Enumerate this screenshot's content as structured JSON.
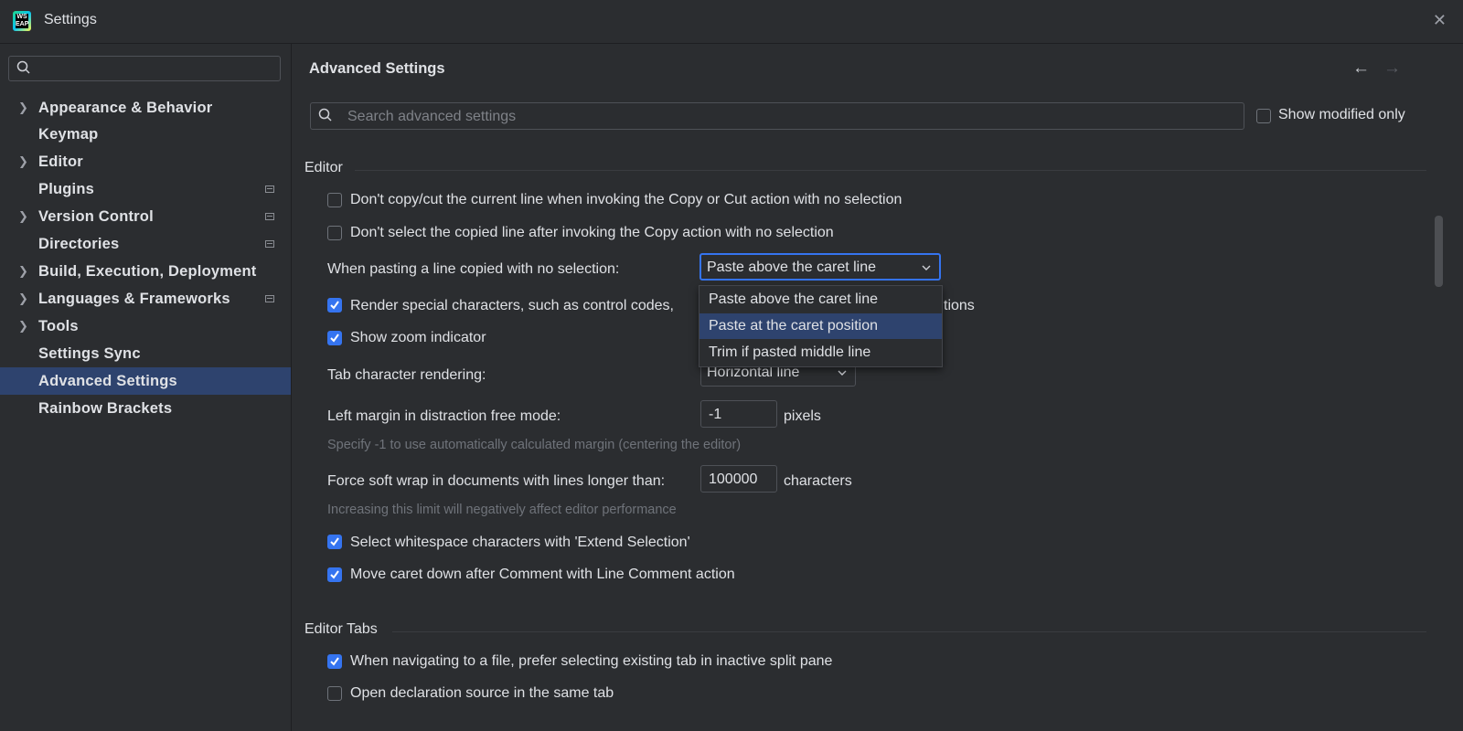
{
  "window": {
    "title": "Settings",
    "logo_text": "WS\nEAP"
  },
  "sidebar": {
    "search_placeholder": "",
    "items": [
      {
        "label": "Appearance & Behavior",
        "expandable": true,
        "badge": false
      },
      {
        "label": "Keymap",
        "expandable": false,
        "badge": false
      },
      {
        "label": "Editor",
        "expandable": true,
        "badge": false
      },
      {
        "label": "Plugins",
        "expandable": false,
        "badge": true
      },
      {
        "label": "Version Control",
        "expandable": true,
        "badge": true
      },
      {
        "label": "Directories",
        "expandable": false,
        "badge": true
      },
      {
        "label": "Build, Execution, Deployment",
        "expandable": true,
        "badge": false
      },
      {
        "label": "Languages & Frameworks",
        "expandable": true,
        "badge": true
      },
      {
        "label": "Tools",
        "expandable": true,
        "badge": false
      },
      {
        "label": "Settings Sync",
        "expandable": false,
        "badge": false
      },
      {
        "label": "Advanced Settings",
        "expandable": false,
        "badge": false,
        "selected": true
      },
      {
        "label": "Rainbow Brackets",
        "expandable": false,
        "badge": false
      }
    ]
  },
  "main": {
    "title": "Advanced Settings",
    "search_placeholder": "Search advanced settings",
    "show_modified_label": "Show modified only",
    "show_modified_checked": false,
    "sections": {
      "editor": {
        "title": "Editor",
        "opt_copy_cut": "Don't copy/cut the current line when invoking the Copy or Cut action with no selection",
        "opt_select_copied": "Don't select the copied line after invoking the Copy action with no selection",
        "paste_label": "When pasting a line copied with no selection:",
        "paste_value": "Paste above the caret line",
        "render_special": "Render special characters, such as control codes,",
        "render_special_tail": "tions",
        "show_zoom": "Show zoom indicator",
        "tab_render_label": "Tab character rendering:",
        "tab_render_value": "Horizontal line",
        "left_margin_label": "Left margin in distraction free mode:",
        "left_margin_value": "-1",
        "left_margin_unit": "pixels",
        "left_margin_hint": "Specify -1 to use automatically calculated margin (centering the editor)",
        "soft_wrap_label": "Force soft wrap in documents with lines longer than:",
        "soft_wrap_value": "100000",
        "soft_wrap_unit": "characters",
        "soft_wrap_hint": "Increasing this limit will negatively affect editor performance",
        "select_whitespace": "Select whitespace characters with 'Extend Selection'",
        "move_caret": "Move caret down after Comment with Line Comment action"
      },
      "editor_tabs": {
        "title": "Editor Tabs",
        "prefer_existing": "When navigating to a file, prefer selecting existing tab in inactive split pane",
        "open_declaration": "Open declaration source in the same tab"
      }
    },
    "popup": {
      "options": [
        "Paste above the caret line",
        "Paste at the caret position",
        "Trim if pasted middle line"
      ],
      "highlighted_index": 1
    }
  },
  "colors": {
    "background": "#2b2d30",
    "accent": "#3574f0",
    "selection": "#2e436e",
    "text": "#dfe1e5",
    "hint": "#6f737a"
  }
}
